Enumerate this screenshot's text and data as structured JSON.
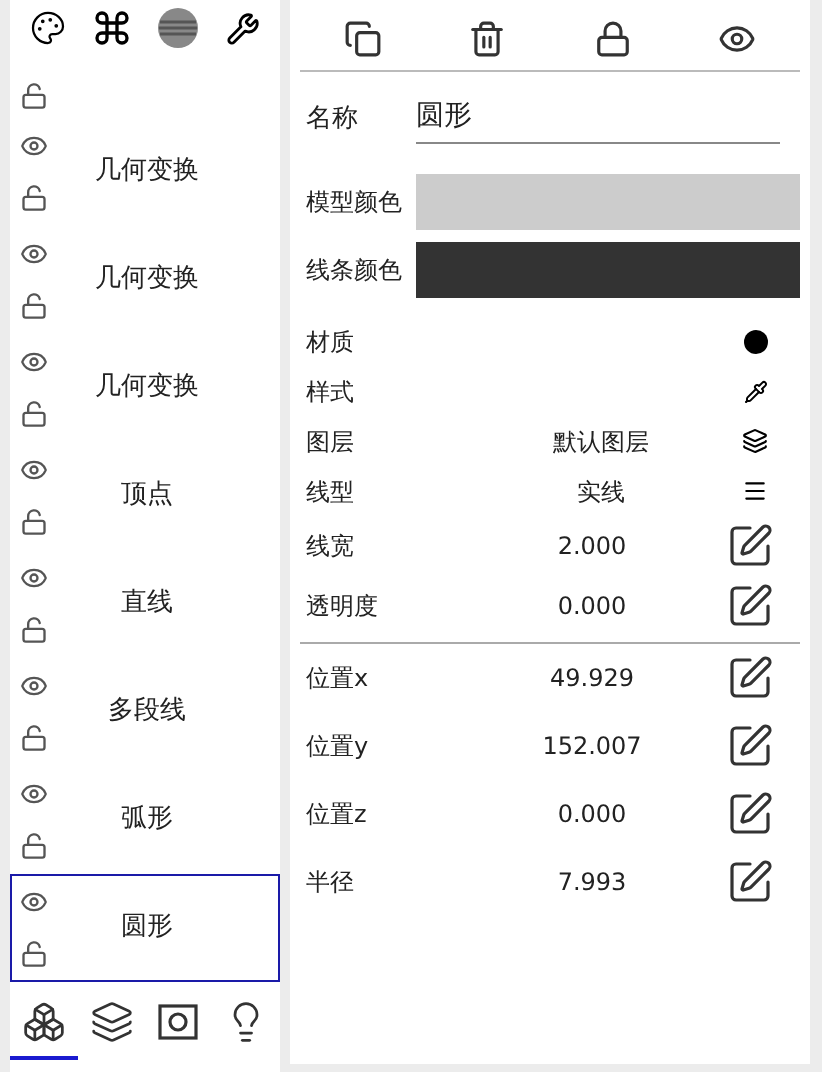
{
  "layer_list": {
    "items": [
      {
        "label": "几何变换",
        "selected": false
      },
      {
        "label": "几何变换",
        "selected": false
      },
      {
        "label": "几何变换",
        "selected": false
      },
      {
        "label": "顶点",
        "selected": false
      },
      {
        "label": "直线",
        "selected": false
      },
      {
        "label": "多段线",
        "selected": false
      },
      {
        "label": "弧形",
        "selected": false
      },
      {
        "label": "圆形",
        "selected": true
      }
    ]
  },
  "bottom_tabs": [
    {
      "kind": "objects",
      "selected": true
    },
    {
      "kind": "layers",
      "selected": false
    },
    {
      "kind": "view",
      "selected": false
    },
    {
      "kind": "light",
      "selected": false
    }
  ],
  "properties": {
    "name": {
      "label": "名称",
      "value": "圆形"
    },
    "colors": [
      {
        "label": "模型颜色",
        "color": "#cccccc"
      },
      {
        "label": "线条颜色",
        "color": "#333333"
      }
    ],
    "attributes": [
      {
        "kind": "material",
        "label": "材质"
      },
      {
        "kind": "style",
        "label": "样式"
      },
      {
        "kind": "layer",
        "label": "图层",
        "value": "默认图层"
      },
      {
        "kind": "linetype",
        "label": "线型",
        "value": "实线"
      },
      {
        "kind": "edit",
        "label": "线宽",
        "value": "2.000"
      },
      {
        "kind": "edit",
        "label": "透明度",
        "value": "0.000"
      }
    ],
    "transform": [
      {
        "label": "位置x",
        "value": "49.929"
      },
      {
        "label": "位置y",
        "value": "152.007"
      },
      {
        "label": "位置z",
        "value": "0.000"
      },
      {
        "label": "半径",
        "value": "7.993"
      }
    ]
  }
}
